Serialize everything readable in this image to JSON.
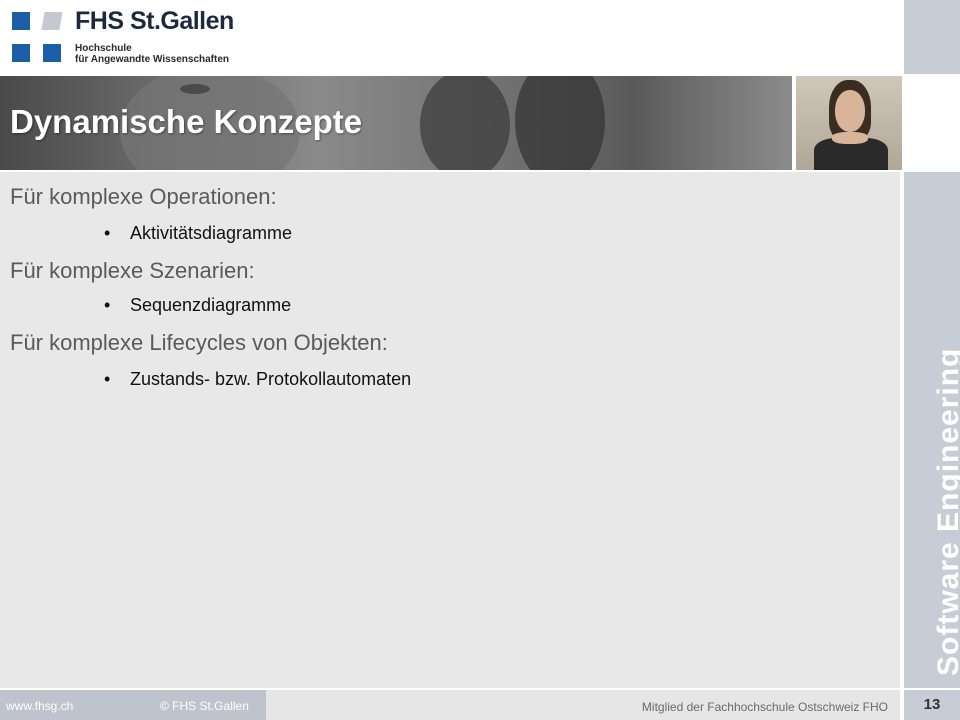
{
  "logo": {
    "title": "FHS St.Gallen",
    "subtitle_line1": "Hochschule",
    "subtitle_line2": "für Angewandte Wissenschaften"
  },
  "banner": {
    "title": "Dynamische Konzepte"
  },
  "sidebar": {
    "vertical_title": "Software Engineering"
  },
  "content": {
    "sections": [
      {
        "heading": "Für komplexe Operationen:",
        "bullet": "Aktivitätsdiagramme"
      },
      {
        "heading": "Für komplexe Szenarien:",
        "bullet": "Sequenzdiagramme"
      },
      {
        "heading": "Für komplexe Lifecycles von Objekten:",
        "bullet": "Zustands- bzw. Protokollautomaten"
      }
    ],
    "bullet_symbol": "•"
  },
  "footer": {
    "url": "www.fhsg.ch",
    "copyright": "© FHS St.Gallen",
    "member": "Mitglied der Fachhochschule Ostschweiz FHO",
    "page_number": "13"
  },
  "colors": {
    "brand_blue": "#1c5ea8",
    "sidebar_gray": "#c8ccd4",
    "content_bg": "#e8e8e8"
  }
}
